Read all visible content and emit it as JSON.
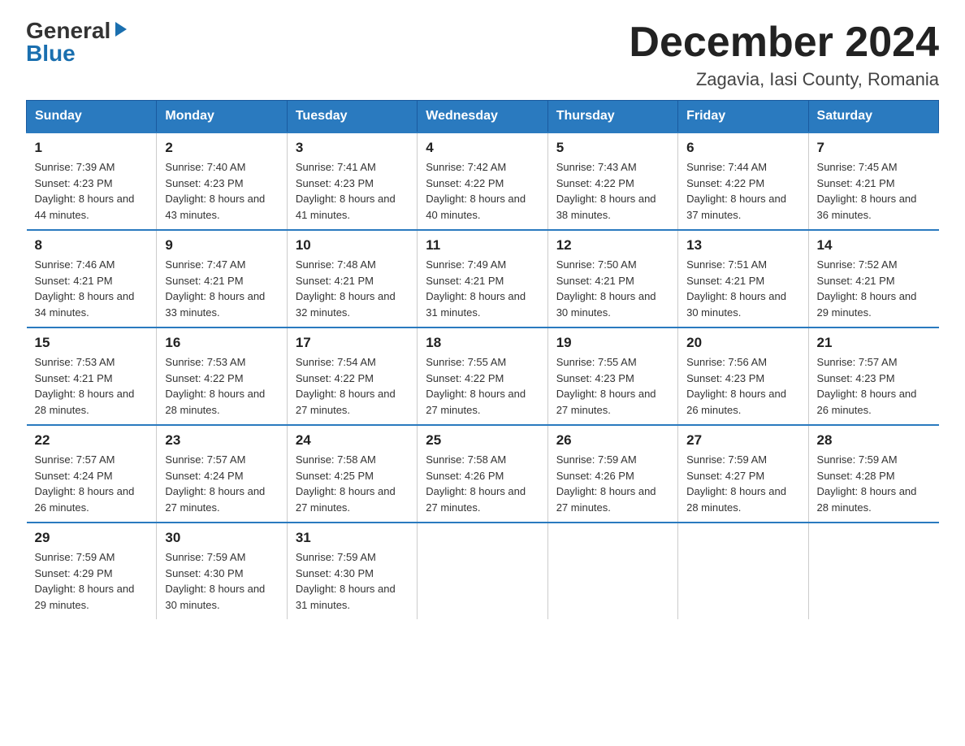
{
  "logo": {
    "general": "General",
    "blue": "Blue"
  },
  "title": "December 2024",
  "location": "Zagavia, Iasi County, Romania",
  "days_of_week": [
    "Sunday",
    "Monday",
    "Tuesday",
    "Wednesday",
    "Thursday",
    "Friday",
    "Saturday"
  ],
  "weeks": [
    [
      {
        "day": "1",
        "sunrise": "7:39 AM",
        "sunset": "4:23 PM",
        "daylight": "8 hours and 44 minutes."
      },
      {
        "day": "2",
        "sunrise": "7:40 AM",
        "sunset": "4:23 PM",
        "daylight": "8 hours and 43 minutes."
      },
      {
        "day": "3",
        "sunrise": "7:41 AM",
        "sunset": "4:23 PM",
        "daylight": "8 hours and 41 minutes."
      },
      {
        "day": "4",
        "sunrise": "7:42 AM",
        "sunset": "4:22 PM",
        "daylight": "8 hours and 40 minutes."
      },
      {
        "day": "5",
        "sunrise": "7:43 AM",
        "sunset": "4:22 PM",
        "daylight": "8 hours and 38 minutes."
      },
      {
        "day": "6",
        "sunrise": "7:44 AM",
        "sunset": "4:22 PM",
        "daylight": "8 hours and 37 minutes."
      },
      {
        "day": "7",
        "sunrise": "7:45 AM",
        "sunset": "4:21 PM",
        "daylight": "8 hours and 36 minutes."
      }
    ],
    [
      {
        "day": "8",
        "sunrise": "7:46 AM",
        "sunset": "4:21 PM",
        "daylight": "8 hours and 34 minutes."
      },
      {
        "day": "9",
        "sunrise": "7:47 AM",
        "sunset": "4:21 PM",
        "daylight": "8 hours and 33 minutes."
      },
      {
        "day": "10",
        "sunrise": "7:48 AM",
        "sunset": "4:21 PM",
        "daylight": "8 hours and 32 minutes."
      },
      {
        "day": "11",
        "sunrise": "7:49 AM",
        "sunset": "4:21 PM",
        "daylight": "8 hours and 31 minutes."
      },
      {
        "day": "12",
        "sunrise": "7:50 AM",
        "sunset": "4:21 PM",
        "daylight": "8 hours and 30 minutes."
      },
      {
        "day": "13",
        "sunrise": "7:51 AM",
        "sunset": "4:21 PM",
        "daylight": "8 hours and 30 minutes."
      },
      {
        "day": "14",
        "sunrise": "7:52 AM",
        "sunset": "4:21 PM",
        "daylight": "8 hours and 29 minutes."
      }
    ],
    [
      {
        "day": "15",
        "sunrise": "7:53 AM",
        "sunset": "4:21 PM",
        "daylight": "8 hours and 28 minutes."
      },
      {
        "day": "16",
        "sunrise": "7:53 AM",
        "sunset": "4:22 PM",
        "daylight": "8 hours and 28 minutes."
      },
      {
        "day": "17",
        "sunrise": "7:54 AM",
        "sunset": "4:22 PM",
        "daylight": "8 hours and 27 minutes."
      },
      {
        "day": "18",
        "sunrise": "7:55 AM",
        "sunset": "4:22 PM",
        "daylight": "8 hours and 27 minutes."
      },
      {
        "day": "19",
        "sunrise": "7:55 AM",
        "sunset": "4:23 PM",
        "daylight": "8 hours and 27 minutes."
      },
      {
        "day": "20",
        "sunrise": "7:56 AM",
        "sunset": "4:23 PM",
        "daylight": "8 hours and 26 minutes."
      },
      {
        "day": "21",
        "sunrise": "7:57 AM",
        "sunset": "4:23 PM",
        "daylight": "8 hours and 26 minutes."
      }
    ],
    [
      {
        "day": "22",
        "sunrise": "7:57 AM",
        "sunset": "4:24 PM",
        "daylight": "8 hours and 26 minutes."
      },
      {
        "day": "23",
        "sunrise": "7:57 AM",
        "sunset": "4:24 PM",
        "daylight": "8 hours and 27 minutes."
      },
      {
        "day": "24",
        "sunrise": "7:58 AM",
        "sunset": "4:25 PM",
        "daylight": "8 hours and 27 minutes."
      },
      {
        "day": "25",
        "sunrise": "7:58 AM",
        "sunset": "4:26 PM",
        "daylight": "8 hours and 27 minutes."
      },
      {
        "day": "26",
        "sunrise": "7:59 AM",
        "sunset": "4:26 PM",
        "daylight": "8 hours and 27 minutes."
      },
      {
        "day": "27",
        "sunrise": "7:59 AM",
        "sunset": "4:27 PM",
        "daylight": "8 hours and 28 minutes."
      },
      {
        "day": "28",
        "sunrise": "7:59 AM",
        "sunset": "4:28 PM",
        "daylight": "8 hours and 28 minutes."
      }
    ],
    [
      {
        "day": "29",
        "sunrise": "7:59 AM",
        "sunset": "4:29 PM",
        "daylight": "8 hours and 29 minutes."
      },
      {
        "day": "30",
        "sunrise": "7:59 AM",
        "sunset": "4:30 PM",
        "daylight": "8 hours and 30 minutes."
      },
      {
        "day": "31",
        "sunrise": "7:59 AM",
        "sunset": "4:30 PM",
        "daylight": "8 hours and 31 minutes."
      },
      null,
      null,
      null,
      null
    ]
  ]
}
